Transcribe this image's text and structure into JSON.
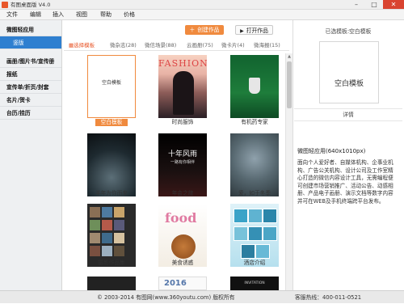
{
  "app": {
    "title": "有图桌面版 V4.0"
  },
  "menu": [
    "文件",
    "编辑",
    "插入",
    "视图",
    "帮助",
    "价格"
  ],
  "sidebar": {
    "items": [
      "微图轻应用",
      "竖版",
      "画册/图片书/宣传册",
      "报纸",
      "宣传单/折页/封套",
      "名片/贺卡",
      "台历/挂历"
    ]
  },
  "toolbar": {
    "create_label": "创建作品",
    "open_label": "打开作品"
  },
  "tabs": [
    {
      "label": "选择模板"
    },
    {
      "label": "微杂志(28)"
    },
    {
      "label": "微信场景(88)"
    },
    {
      "label": "云画册(75)"
    },
    {
      "label": "微卡片(4)"
    },
    {
      "label": "微海报(15)"
    }
  ],
  "thumbnails": [
    {
      "caption": "空白模板",
      "inner": "空白模板"
    },
    {
      "caption": "时尚服饰",
      "headline": "FASHION"
    },
    {
      "caption": "有机药专家"
    },
    {
      "caption": "羊年为你而来"
    },
    {
      "caption": "年会之旅",
      "headline": "十年风雨",
      "subline": "一路有你相伴"
    },
    {
      "caption": "爱，如于冬季"
    },
    {
      "caption": "摄影作品集"
    },
    {
      "caption": "美食诱惑",
      "headline": "food"
    },
    {
      "caption": "酒店介绍"
    },
    {
      "caption": ""
    },
    {
      "caption": "",
      "headline": "2016"
    },
    {
      "caption": "",
      "headline": "INVITATION"
    }
  ],
  "right_panel": {
    "title": "已选模板:空白模板",
    "preview_label": "空白模板",
    "detail_heading": "详情",
    "size": "微图轻应用(640x1010px)",
    "description": "面向个人爱好者、自媒体机构、企事业机构、广告公关机构、设计公司及工作室精心打造的微信内容设计工具，无需编程便可创建市场营销推广、活动公告、动感相册、产品电子画册、演示文档等数字内容并可在WEB及手机终端跨平台发布。"
  },
  "status": {
    "copyright": "© 2003-2014 有图网(www.360youtu.com) 版权所有",
    "phone": "客服热线：400-011-0521"
  },
  "colors": {
    "accent": "#f08a3e",
    "sidebar_active": "#2e7fd0",
    "close": "#d9432f"
  }
}
